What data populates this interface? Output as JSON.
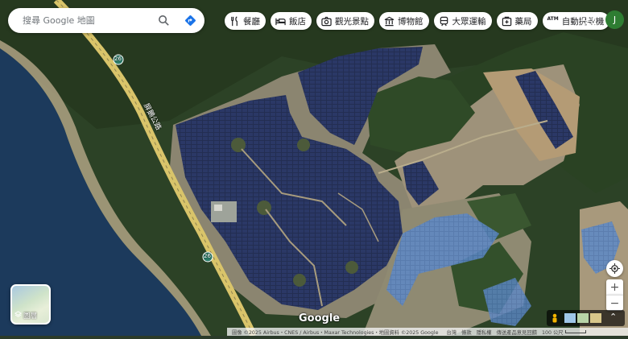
{
  "search": {
    "placeholder": "搜尋 Google 地圖"
  },
  "chips": [
    {
      "label": "餐廳",
      "icon": "restaurant-icon"
    },
    {
      "label": "飯店",
      "icon": "hotel-icon"
    },
    {
      "label": "觀光景點",
      "icon": "camera-icon"
    },
    {
      "label": "博物館",
      "icon": "museum-icon"
    },
    {
      "label": "大眾運輸",
      "icon": "transit-icon"
    },
    {
      "label": "藥局",
      "icon": "pharmacy-icon"
    },
    {
      "label": "自動提款機",
      "icon": "atm-icon",
      "icon_text": "ATM"
    }
  ],
  "account": {
    "initial": "J",
    "color": "#2e7d32"
  },
  "layers": {
    "label": "圖層"
  },
  "map": {
    "road_name": "屏鵝公路",
    "route_number": "26",
    "logo": "Google"
  },
  "footer": {
    "imagery": "圖像 ©2025 Airbus・CNES / Airbus・Maxar Technologies・地圖資料 ©2025 Google",
    "links": [
      "台灣",
      "條款",
      "隱私權",
      "傳送產品意見回饋"
    ],
    "scale": "100 公尺"
  },
  "colors": {
    "panel": "#1e2a4a",
    "road": "#d9c46a",
    "sea": "#1c3a5c",
    "forest": "#24371f",
    "accent": "#1a73e8"
  }
}
